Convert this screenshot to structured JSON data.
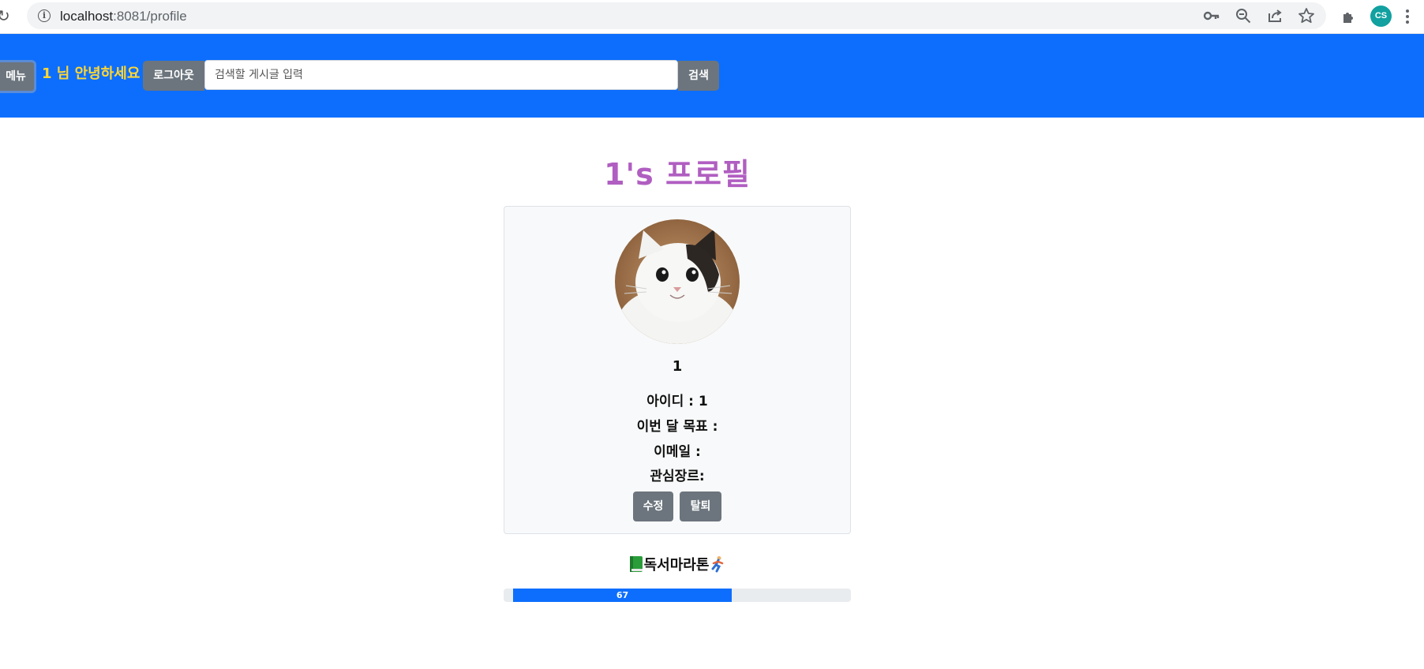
{
  "browser": {
    "url_host": "localhost",
    "url_path": ":8081/profile",
    "profile_initials": "CS"
  },
  "navbar": {
    "menu_label": "메뉴",
    "greeting": "1 님 안녕하세요",
    "logout_label": "로그아웃",
    "search_placeholder": "검색할 게시글 입력",
    "search_label": "검색"
  },
  "profile": {
    "title": "1's 프로필",
    "name": "1",
    "id_line": "아이디 : 1",
    "goal_line": "이번 달 목표 :",
    "email_line": "이메일 :",
    "genre_line": "관심장르:",
    "edit_label": "수정",
    "withdraw_label": "탈퇴"
  },
  "marathon": {
    "title": "독서마라톤",
    "progress_label": "67",
    "progress_percent": 63
  },
  "colors": {
    "navbar": "#0d6efd",
    "greeting": "#ffd633",
    "title": "#b05ec1",
    "button_gray": "#6c757d"
  }
}
